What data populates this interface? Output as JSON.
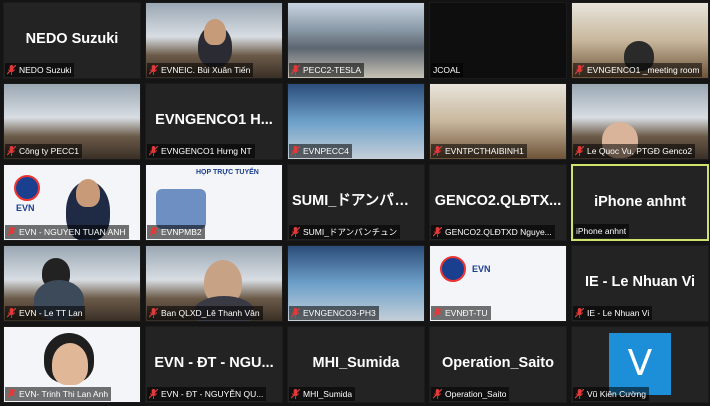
{
  "participants": [
    {
      "display_name": "NEDO Suzuki",
      "center_name": "NEDO Suzuki"
    },
    {
      "display_name": "EVNEIC. Bùi Xuân Tiến"
    },
    {
      "display_name": "PECC2-TESLA"
    },
    {
      "display_name": "JCOAL"
    },
    {
      "display_name": "EVNGENCO1 _meeting room"
    },
    {
      "display_name": "Công ty PECC1"
    },
    {
      "display_name": "EVNGENCO1 Hưng NT",
      "center_name": "EVNGENCO1 H..."
    },
    {
      "display_name": "EVNPECC4"
    },
    {
      "display_name": "EVNTPCTHAIBINH1"
    },
    {
      "display_name": "Le Quoc Vu, PTGĐ Genco2"
    },
    {
      "display_name": "EVN - NGUYEN TUAN ANH",
      "logo_text": "EVN"
    },
    {
      "display_name": "EVNPMB2",
      "slide_title": "HỌP TRỰC TUYẾN"
    },
    {
      "display_name": "SUMI_ドアンパンチュン",
      "center_name": "SUMI_ドアンパン..."
    },
    {
      "display_name": "GENCO2.QLĐTXD Nguye...",
      "center_name": "GENCO2.QLĐTX..."
    },
    {
      "display_name": "iPhone anhnt",
      "center_name": "iPhone anhnt",
      "active": true
    },
    {
      "display_name": "EVN - Le TT Lan"
    },
    {
      "display_name": "Ban QLXD_Lê Thanh Vân"
    },
    {
      "display_name": "EVNGENCO3-PH3"
    },
    {
      "display_name": "EVNĐT-TU",
      "logo_text": "EVN"
    },
    {
      "display_name": "IE - Le Nhuan Vi",
      "center_name": "IE - Le Nhuan Vi"
    },
    {
      "display_name": "EVN- Trinh Thi Lan Anh"
    },
    {
      "display_name": "EVN - ĐT - NGUYỄN QU...",
      "center_name": "EVN - ĐT - NGU..."
    },
    {
      "display_name": "MHI_Sumida",
      "center_name": "MHI_Sumida"
    },
    {
      "display_name": "Operation_Saito",
      "center_name": "Operation_Saito"
    },
    {
      "display_name": "Vũ Kiên Cường",
      "avatar_letter": "V"
    }
  ],
  "colors": {
    "background": "#141414",
    "tile": "#232323",
    "active_border": "#cfe26b",
    "muted_mic": "#e03a3a",
    "avatar": "#1c8fd8"
  },
  "icons": {
    "muted": "mic-muted-icon"
  }
}
